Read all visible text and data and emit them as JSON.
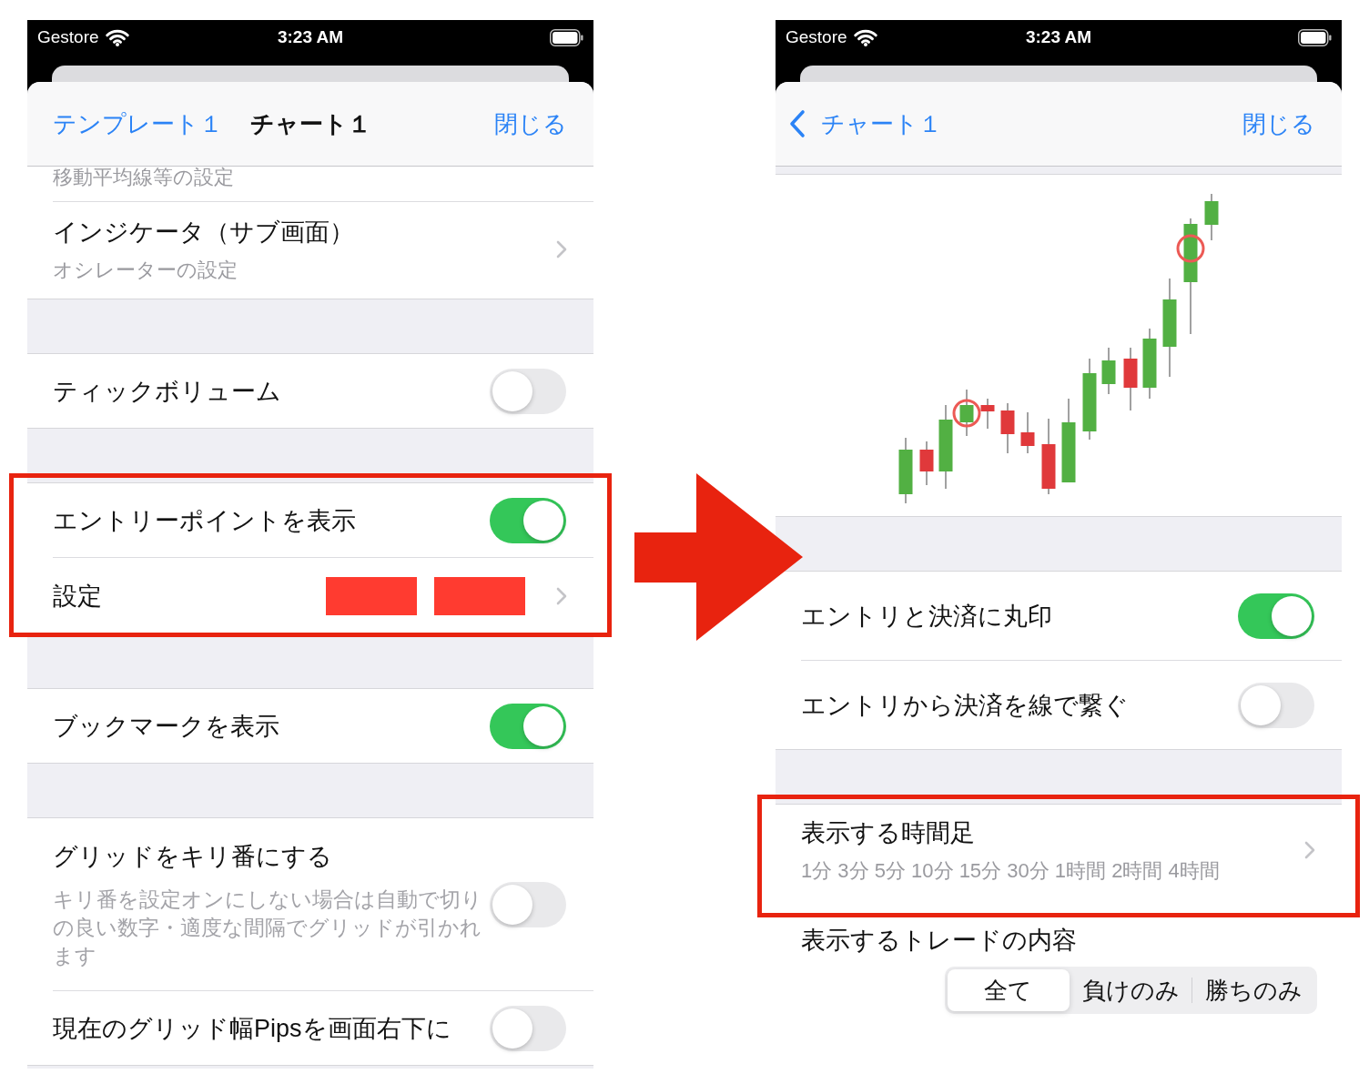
{
  "screens": [
    {
      "status_bar": {
        "carrier": "Gestore",
        "time": "3:23 AM"
      },
      "nav": {
        "back": {
          "label": "テンプレート１",
          "chevron": false
        },
        "title": "チャート１",
        "close": "閉じる"
      },
      "blocks": [
        {
          "kind": "group",
          "highlighted": false,
          "rows": [
            {
              "kind": "caption",
              "subtitle": "移動平均線等の設定"
            },
            {
              "kind": "link",
              "title": "インジケータ（サブ画面）",
              "subtitle": "オシレーターの設定"
            }
          ]
        },
        {
          "kind": "group",
          "highlighted": false,
          "rows": [
            {
              "kind": "toggle",
              "title": "ティックボリューム",
              "on": false
            }
          ]
        },
        {
          "kind": "group",
          "highlighted": true,
          "rows": [
            {
              "kind": "toggle",
              "title": "エントリーポイントを表示",
              "on": true
            },
            {
              "kind": "swatches",
              "title": "設定",
              "swatches": [
                {
                  "color": "#ff3b30"
                },
                {
                  "color": "#ff3b30"
                }
              ]
            }
          ]
        },
        {
          "kind": "group",
          "highlighted": false,
          "rows": [
            {
              "kind": "toggle",
              "title": "ブックマークを表示",
              "on": true
            }
          ]
        },
        {
          "kind": "group",
          "highlighted": false,
          "rows": [
            {
              "kind": "toggle",
              "title": "グリッドをキリ番にする",
              "subtitle": "キリ番を設定オンにしない場合は自動で切りの良い数字・適度な間隔でグリッドが引かれます",
              "on": false
            },
            {
              "kind": "toggle",
              "title": "現在のグリッド幅Pipsを画面右下に",
              "on": false
            }
          ]
        }
      ]
    },
    {
      "status_bar": {
        "carrier": "Gestore",
        "time": "3:23 AM"
      },
      "nav": {
        "back": {
          "label": "チャート１",
          "chevron": true
        },
        "close": "閉じる"
      },
      "blocks": [
        {
          "kind": "chart"
        },
        {
          "kind": "group",
          "highlighted": false,
          "rows": [
            {
              "kind": "toggle",
              "title": "エントリと決済に丸印",
              "on": true
            },
            {
              "kind": "toggle",
              "title": "エントリから決済を線で繋ぐ",
              "on": false
            }
          ]
        },
        {
          "kind": "group",
          "highlighted": true,
          "rows": [
            {
              "kind": "link",
              "title": "表示する時間足",
              "subtitle": "1分 3分 5分 10分 15分 30分 1時間 2時間 4時間"
            }
          ]
        },
        {
          "kind": "segmented",
          "title": "表示するトレードの内容",
          "segments": [
            {
              "label": "全て",
              "selected": true
            },
            {
              "label": "負けのみ",
              "selected": false
            },
            {
              "label": "勝ちのみ",
              "selected": false
            }
          ]
        }
      ]
    }
  ]
}
